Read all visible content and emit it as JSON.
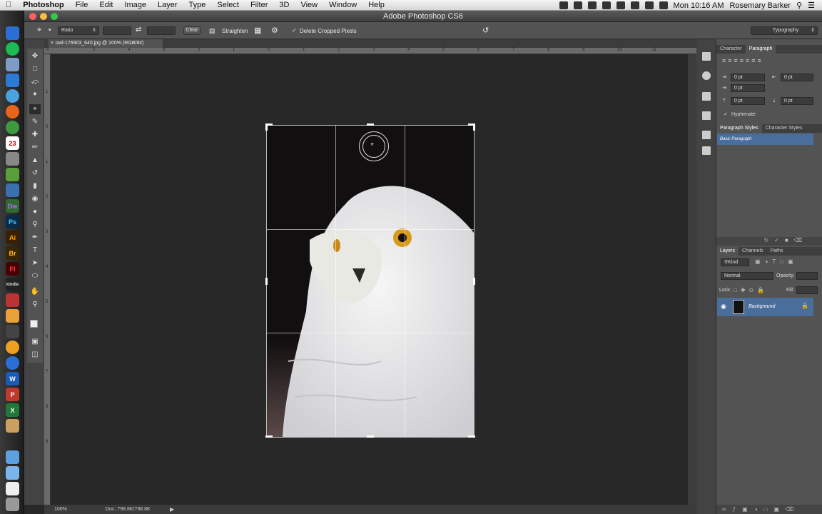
{
  "menubar": {
    "apple_icon": "apple-icon",
    "items": [
      "Photoshop",
      "File",
      "Edit",
      "Image",
      "Layer",
      "Type",
      "Select",
      "Filter",
      "3D",
      "View",
      "Window",
      "Help"
    ],
    "clock": "Mon 10:16 AM",
    "user": "Rosemary Barker"
  },
  "window": {
    "title": "Adobe Photoshop CS6"
  },
  "dock": {
    "labels": [
      "23",
      "Dw",
      "Ps",
      "Ai",
      "Br",
      "Fl",
      "kindle",
      "W",
      "P",
      "X"
    ]
  },
  "options": {
    "ratio": "Ratio",
    "clear": "Clear",
    "straighten": "Straighten",
    "delete_cropped": "Delete Cropped Pixels",
    "workspace": "Typography"
  },
  "document": {
    "tab": "owl-176903_640.jpg @ 100% (RGB/8#)",
    "ruler_top": [
      "6",
      "5",
      "4",
      "3",
      "2",
      "1",
      "0",
      "1",
      "2",
      "3",
      "4",
      "5",
      "6",
      "7",
      "8",
      "9",
      "10",
      "11"
    ],
    "ruler_left": [
      "1",
      "0",
      "1",
      "2",
      "3",
      "4",
      "5",
      "6",
      "7",
      "8",
      "9"
    ]
  },
  "status": {
    "zoom": "100%",
    "doc": "Doc: 798.8K/798.8K"
  },
  "character_panel": {
    "tabs": [
      "Character",
      "Paragraph"
    ],
    "indent_left": "0 pt",
    "indent_right": "0 pt",
    "first_line": "0 pt",
    "space_before": "0 pt",
    "space_after": "0 pt",
    "hyphenate": "Hyphenate"
  },
  "styles_panel": {
    "tabs": [
      "Paragraph Styles",
      "Character Styles"
    ],
    "item": "Basic Paragraph"
  },
  "layers_panel": {
    "tabs": [
      "Layers",
      "Channels",
      "Paths"
    ],
    "kind": "Kind",
    "blend": "Normal",
    "opacity_label": "Opacity:",
    "lock_label": "Lock:",
    "fill_label": "Fill:",
    "layer_name": "Background"
  }
}
